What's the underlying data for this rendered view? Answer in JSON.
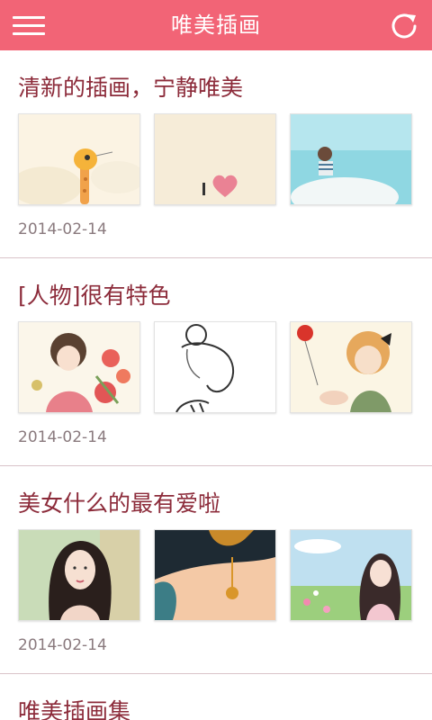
{
  "header": {
    "title": "唯美插画",
    "menu_icon": "hamburger-menu-icon",
    "refresh_icon": "refresh-icon"
  },
  "colors": {
    "accent": "#f26476",
    "title_text": "#8c2b3a",
    "date_text": "#8a7a7e",
    "divider": "#d9c3c9"
  },
  "posts": [
    {
      "title": "清新的插画，宁静唯美",
      "date": "2014-02-14",
      "images": [
        "giraffe-illustration",
        "i-heart-illustration",
        "seaside-girl-illustration"
      ]
    },
    {
      "title": "[人物]很有特色",
      "date": "2014-02-14",
      "images": [
        "girl-with-flowers-illustration",
        "sketch-girl-illustration",
        "girl-with-balloon-illustration"
      ]
    },
    {
      "title": "美女什么的最有爱啦",
      "date": "2014-02-14",
      "images": [
        "long-hair-beauty-illustration",
        "hair-ornament-illustration",
        "girl-in-flower-field-illustration"
      ]
    },
    {
      "title": "唯美插画集"
    }
  ]
}
